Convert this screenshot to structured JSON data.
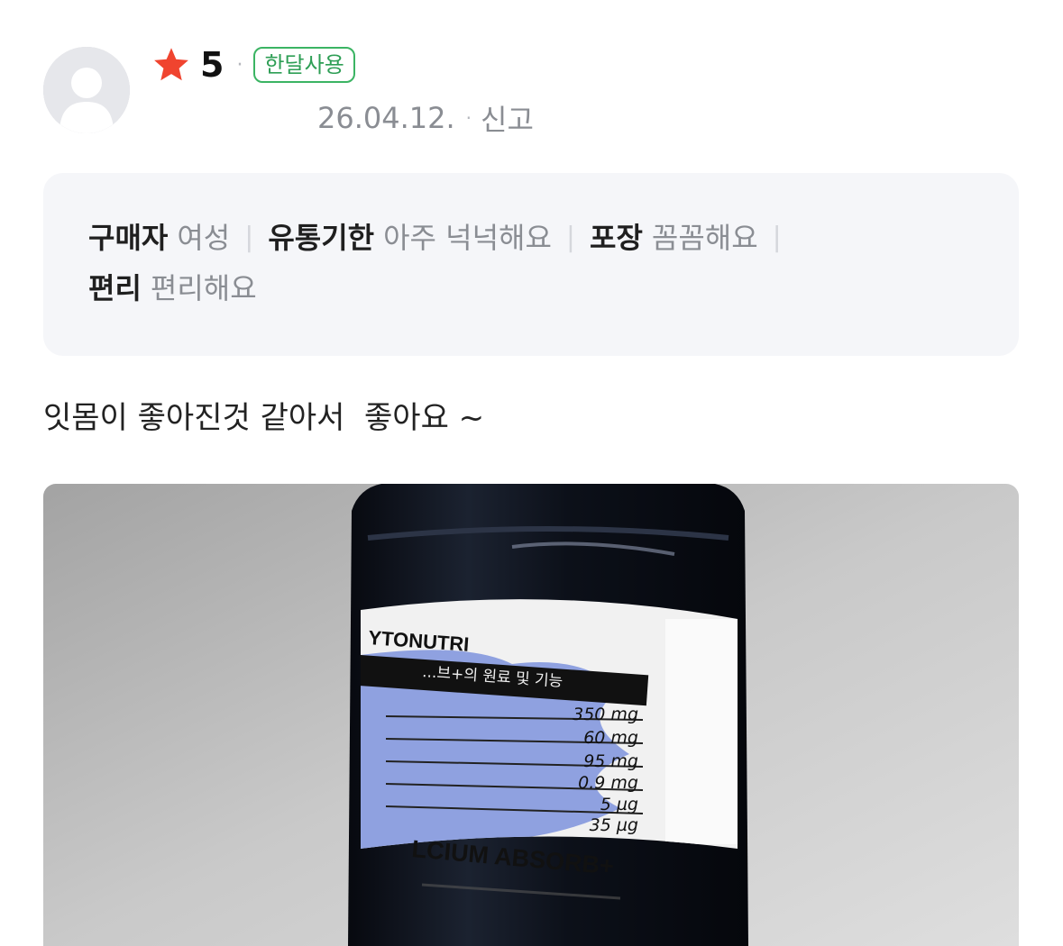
{
  "review": {
    "rating": "5",
    "usage_badge": "한달사용",
    "date": "26.04.12.",
    "report_label": "신고",
    "text": "잇몸이 좋아진것 같아서  좋아요 ~"
  },
  "attributes": [
    {
      "key": "구매자",
      "value": "여성"
    },
    {
      "key": "유통기한",
      "value": "아주 넉넉해요"
    },
    {
      "key": "포장",
      "value": "꼼꼼해요"
    },
    {
      "key": "편리",
      "value": "편리해요"
    }
  ],
  "photo": {
    "brand_text": "YTONUTRI",
    "subtitle_text": "...브+의 원료 및 기능",
    "product_text": "LCIUM ABSORB+",
    "amounts": [
      "350 mg",
      "60 mg",
      "95 mg",
      "0.9 mg",
      "5 µg",
      "35 µg"
    ]
  },
  "colors": {
    "star": "#f0442f",
    "badge": "#3bb463",
    "box_bg": "#f5f6f9",
    "label_accent": "#8fa1e0"
  }
}
